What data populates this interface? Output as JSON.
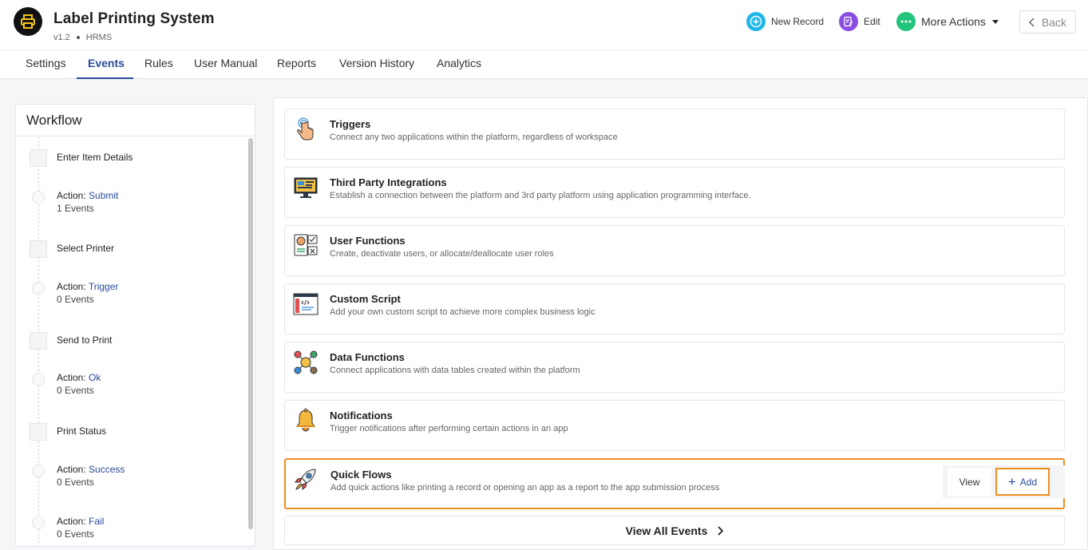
{
  "header": {
    "title": "Label Printing System",
    "version": "v1.2",
    "module": "HRMS",
    "new_record": "New Record",
    "edit": "Edit",
    "more_actions": "More Actions",
    "back": "Back",
    "colors": {
      "new_record": "#1fb6e6",
      "edit": "#8a4ee0",
      "more_actions": "#22c37a"
    }
  },
  "tabs": [
    {
      "label": "Settings",
      "active": false
    },
    {
      "label": "Events",
      "active": true
    },
    {
      "label": "Rules",
      "active": false
    },
    {
      "label": "User Manual",
      "active": false
    },
    {
      "label": "Reports",
      "active": false
    },
    {
      "label": "Version History",
      "active": false
    },
    {
      "label": "Analytics",
      "active": false
    }
  ],
  "workflow": {
    "title": "Workflow",
    "steps": [
      {
        "name": "Enter Item Details",
        "action_prefix": "Action:",
        "action": "Submit",
        "events": "1 Events"
      },
      {
        "name": "Select Printer",
        "action_prefix": "Action:",
        "action": "Trigger",
        "events": "0 Events"
      },
      {
        "name": "Send to Print",
        "action_prefix": "Action:",
        "action": "Ok",
        "events": "0 Events"
      },
      {
        "name": "Print Status",
        "action_prefix": "Action:",
        "action": "Success",
        "events": "0 Events"
      },
      {
        "name": "",
        "action_prefix": "Action:",
        "action": "Fail",
        "events": "0 Events"
      }
    ]
  },
  "events": {
    "cards": [
      {
        "title": "Triggers",
        "desc": "Connect any two applications within the platform, regardless of workspace",
        "icon": "pointer-hand-icon"
      },
      {
        "title": "Third Party Integrations",
        "desc": "Establish a connection between the platform and 3rd party platform using application programming interface.",
        "icon": "monitor-api-icon"
      },
      {
        "title": "User Functions",
        "desc": "Create, deactivate users, or allocate/deallocate user roles",
        "icon": "user-roles-icon"
      },
      {
        "title": "Custom Script",
        "desc": "Add your own custom script to achieve more complex business logic",
        "icon": "code-window-icon"
      },
      {
        "title": "Data Functions",
        "desc": "Connect applications with data tables created within the platform",
        "icon": "data-network-icon"
      },
      {
        "title": "Notifications",
        "desc": "Trigger notifications after performing certain actions in an app",
        "icon": "bell-icon"
      },
      {
        "title": "Quick Flows",
        "desc": "Add quick actions like printing a record or opening an app as a report to the app submission process",
        "icon": "rocket-icon"
      }
    ],
    "view_label": "View",
    "add_label": "Add",
    "view_all": "View All Events",
    "highlight_color": "#ef8d22"
  }
}
